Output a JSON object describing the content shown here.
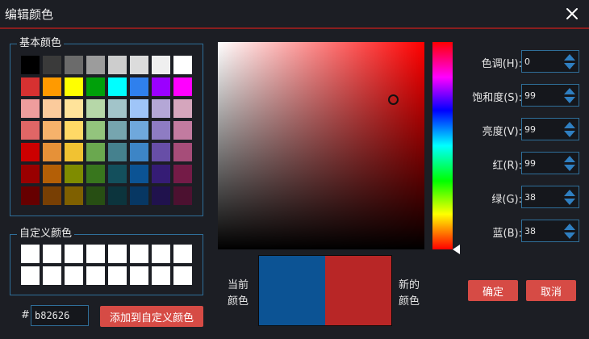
{
  "dialog": {
    "title": "编辑颜色",
    "close_icon": "close-icon"
  },
  "basic_colors": {
    "label": "基本颜色",
    "swatches": [
      "#000000",
      "#3a3a3a",
      "#6b6b6b",
      "#9c9c9c",
      "#cdcdcd",
      "#dcdcdc",
      "#efefef",
      "#ffffff",
      "#d63131",
      "#ff9a00",
      "#ffff00",
      "#00a00a",
      "#00ffff",
      "#2f80ed",
      "#9b00ff",
      "#ff00ff",
      "#ee9d9d",
      "#fbcb9c",
      "#ffe39a",
      "#b6d7a8",
      "#a2c4c9",
      "#9fc5f8",
      "#b4a7d6",
      "#d5a6bd",
      "#e06666",
      "#f6b26b",
      "#ffd966",
      "#93c47d",
      "#76a5af",
      "#6fa8dc",
      "#8e7cc3",
      "#c27ba0",
      "#cc0000",
      "#e69138",
      "#f1c232",
      "#6aa84f",
      "#45818e",
      "#3d85c6",
      "#674ea7",
      "#a64d79",
      "#990000",
      "#b45f06",
      "#7f8c00",
      "#38761d",
      "#134f5c",
      "#0b5394",
      "#351c75",
      "#741b47",
      "#660000",
      "#783f04",
      "#7f6000",
      "#274e13",
      "#0c343d",
      "#073763",
      "#20124d",
      "#4c1130"
    ]
  },
  "custom_colors": {
    "label": "自定义颜色",
    "swatches": [
      "#ffffff",
      "#ffffff",
      "#ffffff",
      "#ffffff",
      "#ffffff",
      "#ffffff",
      "#ffffff",
      "#ffffff",
      "#ffffff",
      "#ffffff",
      "#ffffff",
      "#ffffff",
      "#ffffff",
      "#ffffff",
      "#ffffff",
      "#ffffff"
    ]
  },
  "hex": {
    "prefix": "#",
    "value": "b82626"
  },
  "add_custom_button": "添加到自定义颜色",
  "picker": {
    "hue_deg": 0,
    "saturation": 0.85,
    "value": 0.72,
    "hue_bar_marker": 1.0,
    "hue_area_color": "#ff0000"
  },
  "preview": {
    "current_label": "当前颜色",
    "new_label": "新的颜色",
    "current_color": "#0c5394",
    "new_color": "#b82626"
  },
  "fields": [
    {
      "label": "色调(H):",
      "value": "0",
      "name": "hue"
    },
    {
      "label": "饱和度(S):",
      "value": "99",
      "name": "saturation"
    },
    {
      "label": "亮度(V):",
      "value": "99",
      "name": "brightness"
    },
    {
      "label": "红(R):",
      "value": "99",
      "name": "red"
    },
    {
      "label": "绿(G):",
      "value": "38",
      "name": "green"
    },
    {
      "label": "蓝(B):",
      "value": "38",
      "name": "blue"
    }
  ],
  "buttons": {
    "ok": "确定",
    "cancel": "取消"
  },
  "colors": {
    "accent": "#d64b45",
    "border": "#2f6f9a",
    "title_underline": "#8a1e1e",
    "spinner_arrow": "#2f7fc1"
  }
}
